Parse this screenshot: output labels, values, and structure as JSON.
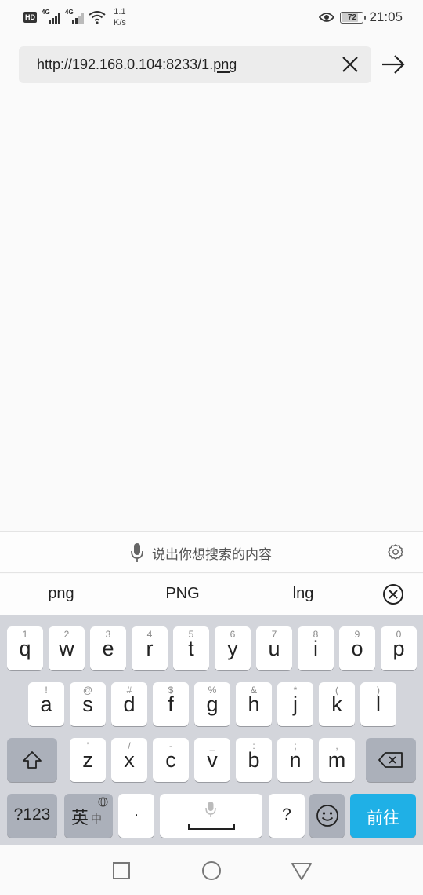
{
  "status_bar": {
    "hd_badge": "HD",
    "sim1": "4G",
    "sim2": "4G",
    "speed_value": "1.1",
    "speed_unit": "K/s",
    "battery": "72",
    "time": "21:05"
  },
  "url_bar": {
    "url_prefix": "http://192.168.0.104:8233/1.",
    "url_composing": "png"
  },
  "voice_bar": {
    "hint": "说出你想搜索的内容"
  },
  "suggestions": [
    "png",
    "PNG",
    "lng"
  ],
  "keyboard": {
    "row1": [
      {
        "alt": "1",
        "key": "q"
      },
      {
        "alt": "2",
        "key": "w"
      },
      {
        "alt": "3",
        "key": "e"
      },
      {
        "alt": "4",
        "key": "r"
      },
      {
        "alt": "5",
        "key": "t"
      },
      {
        "alt": "6",
        "key": "y"
      },
      {
        "alt": "7",
        "key": "u"
      },
      {
        "alt": "8",
        "key": "i"
      },
      {
        "alt": "9",
        "key": "o"
      },
      {
        "alt": "0",
        "key": "p"
      }
    ],
    "row2": [
      {
        "alt": "!",
        "key": "a"
      },
      {
        "alt": "@",
        "key": "s"
      },
      {
        "alt": "#",
        "key": "d"
      },
      {
        "alt": "$",
        "key": "f"
      },
      {
        "alt": "%",
        "key": "g"
      },
      {
        "alt": "&",
        "key": "h"
      },
      {
        "alt": "*",
        "key": "j"
      },
      {
        "alt": "(",
        "key": "k"
      },
      {
        "alt": ")",
        "key": "l"
      }
    ],
    "row3": [
      {
        "alt": "'",
        "key": "z"
      },
      {
        "alt": "/",
        "key": "x"
      },
      {
        "alt": "-",
        "key": "c"
      },
      {
        "alt": "_",
        "key": "v"
      },
      {
        "alt": ":",
        "key": "b"
      },
      {
        "alt": ";",
        "key": "n"
      },
      {
        "alt": ",",
        "key": "m"
      }
    ],
    "numbers_label": "?123",
    "lang_main": "英",
    "lang_sub": "中",
    "dot_label": "·",
    "question_label": "?",
    "go_label": "前往"
  },
  "icons": {
    "clear": "close-icon",
    "go": "arrow-right-icon",
    "mic": "microphone-icon",
    "settings": "gear-icon",
    "suggestion_close": "circle-x-icon",
    "shift": "shift-icon",
    "backspace": "backspace-icon",
    "emoji": "emoji-icon",
    "globe": "globe-icon",
    "recent": "square-icon",
    "home": "circle-icon",
    "back": "triangle-icon",
    "eye": "eye-icon",
    "wifi": "wifi-icon"
  },
  "colors": {
    "accent": "#1fb0e6",
    "keyboard_bg": "#d3d5db",
    "key_dark": "#abb0ba"
  }
}
